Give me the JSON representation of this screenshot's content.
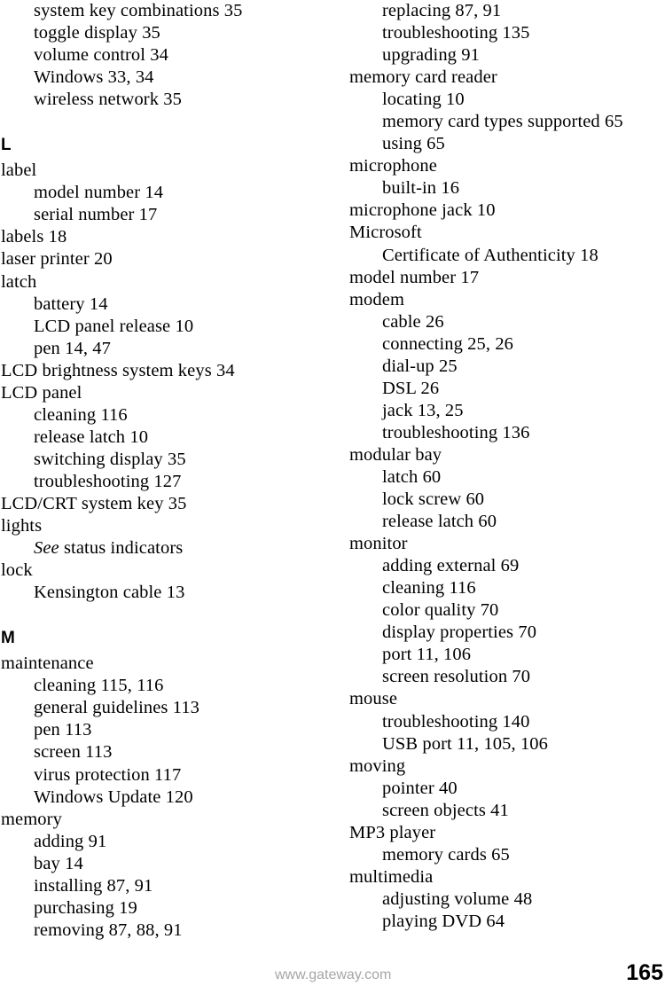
{
  "page": {
    "number": "165",
    "footer_url": "www.gateway.com"
  },
  "columns": [
    {
      "name": "left-column",
      "entries": [
        {
          "kind": "sub",
          "text": "system key combinations  35"
        },
        {
          "kind": "sub",
          "text": "toggle display  35"
        },
        {
          "kind": "sub",
          "text": "volume control  34"
        },
        {
          "kind": "sub",
          "text": "Windows  33, 34"
        },
        {
          "kind": "sub",
          "text": "wireless network  35"
        },
        {
          "kind": "letter",
          "text": "L"
        },
        {
          "kind": "main",
          "text": "label"
        },
        {
          "kind": "sub",
          "text": "model number  14"
        },
        {
          "kind": "sub",
          "text": "serial number  17"
        },
        {
          "kind": "main",
          "text": "labels  18"
        },
        {
          "kind": "main",
          "text": "laser printer  20"
        },
        {
          "kind": "main",
          "text": "latch"
        },
        {
          "kind": "sub",
          "text": "battery  14"
        },
        {
          "kind": "sub",
          "text": "LCD panel release  10"
        },
        {
          "kind": "sub",
          "text": "pen  14, 47"
        },
        {
          "kind": "main",
          "text": "LCD brightness system keys  34"
        },
        {
          "kind": "main",
          "text": "LCD panel"
        },
        {
          "kind": "sub",
          "text": "cleaning  116"
        },
        {
          "kind": "sub",
          "text": "release latch  10"
        },
        {
          "kind": "sub",
          "text": "switching display  35"
        },
        {
          "kind": "sub",
          "text": "troubleshooting  127"
        },
        {
          "kind": "main",
          "text": "LCD/CRT system key  35"
        },
        {
          "kind": "main",
          "text": "lights"
        },
        {
          "kind": "see",
          "italic": "See",
          "text": " status indicators"
        },
        {
          "kind": "main",
          "text": "lock"
        },
        {
          "kind": "sub",
          "text": "Kensington cable  13"
        },
        {
          "kind": "letter",
          "text": "M"
        },
        {
          "kind": "main",
          "text": "maintenance"
        },
        {
          "kind": "sub",
          "text": "cleaning  115, 116"
        },
        {
          "kind": "sub",
          "text": "general guidelines  113"
        },
        {
          "kind": "sub",
          "text": "pen  113"
        },
        {
          "kind": "sub",
          "text": "screen  113"
        },
        {
          "kind": "sub",
          "text": "virus protection  117"
        },
        {
          "kind": "sub",
          "text": "Windows Update  120"
        },
        {
          "kind": "main",
          "text": "memory"
        },
        {
          "kind": "sub",
          "text": "adding  91"
        },
        {
          "kind": "sub",
          "text": "bay  14"
        },
        {
          "kind": "sub",
          "text": "installing 87, 91"
        },
        {
          "kind": "sub",
          "text": "purchasing  19"
        },
        {
          "kind": "sub",
          "text": "removing  87, 88, 91"
        }
      ]
    },
    {
      "name": "right-column",
      "entries": [
        {
          "kind": "sub",
          "text": "replacing  87, 91"
        },
        {
          "kind": "sub",
          "text": "troubleshooting  135"
        },
        {
          "kind": "sub",
          "text": "upgrading  91"
        },
        {
          "kind": "main",
          "text": "memory card reader"
        },
        {
          "kind": "sub",
          "text": "locating  10"
        },
        {
          "kind": "sub",
          "text": "memory card types supported 65"
        },
        {
          "kind": "sub",
          "text": "using  65"
        },
        {
          "kind": "main",
          "text": "microphone"
        },
        {
          "kind": "sub",
          "text": "built-in  16"
        },
        {
          "kind": "main",
          "text": "microphone jack  10"
        },
        {
          "kind": "main",
          "text": "Microsoft"
        },
        {
          "kind": "sub",
          "text": "Certificate of Authenticity  18"
        },
        {
          "kind": "main",
          "text": "model number  17"
        },
        {
          "kind": "main",
          "text": "modem"
        },
        {
          "kind": "sub",
          "text": "cable  26"
        },
        {
          "kind": "sub",
          "text": "connecting 25, 26"
        },
        {
          "kind": "sub",
          "text": "dial-up  25"
        },
        {
          "kind": "sub",
          "text": "DSL  26"
        },
        {
          "kind": "sub",
          "text": "jack  13, 25"
        },
        {
          "kind": "sub",
          "text": "troubleshooting  136"
        },
        {
          "kind": "main",
          "text": "modular bay"
        },
        {
          "kind": "sub",
          "text": "latch  60"
        },
        {
          "kind": "sub",
          "text": "lock screw  60"
        },
        {
          "kind": "sub",
          "text": "release latch  60"
        },
        {
          "kind": "main",
          "text": "monitor"
        },
        {
          "kind": "sub",
          "text": "adding external  69"
        },
        {
          "kind": "sub",
          "text": "cleaning  116"
        },
        {
          "kind": "sub",
          "text": "color quality  70"
        },
        {
          "kind": "sub",
          "text": "display properties  70"
        },
        {
          "kind": "sub",
          "text": "port  11, 106"
        },
        {
          "kind": "sub",
          "text": "screen resolution  70"
        },
        {
          "kind": "main",
          "text": "mouse"
        },
        {
          "kind": "sub",
          "text": "troubleshooting  140"
        },
        {
          "kind": "sub",
          "text": "USB port  11, 105, 106"
        },
        {
          "kind": "main",
          "text": "moving"
        },
        {
          "kind": "sub",
          "text": "pointer  40"
        },
        {
          "kind": "sub",
          "text": "screen objects  41"
        },
        {
          "kind": "main",
          "text": "MP3 player"
        },
        {
          "kind": "sub",
          "text": "memory cards  65"
        },
        {
          "kind": "main",
          "text": "multimedia"
        },
        {
          "kind": "sub",
          "text": "adjusting volume  48"
        },
        {
          "kind": "sub",
          "text": "playing DVD  64"
        }
      ]
    }
  ]
}
